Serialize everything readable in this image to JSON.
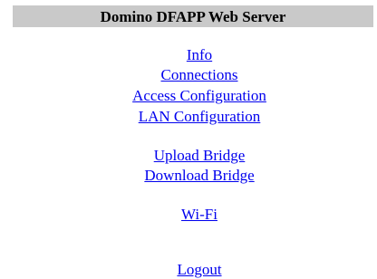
{
  "header": {
    "title": "Domino DFAPP Web Server"
  },
  "menu": {
    "group1": [
      {
        "label": "Info"
      },
      {
        "label": "Connections"
      },
      {
        "label": "Access Configuration"
      },
      {
        "label": "LAN Configuration"
      }
    ],
    "group2": [
      {
        "label": "Upload Bridge"
      },
      {
        "label": "Download Bridge"
      }
    ],
    "group3": [
      {
        "label": "Wi-Fi"
      }
    ],
    "logout": {
      "label": "Logout"
    }
  },
  "colors": {
    "header_bg": "#c9c9c9",
    "link": "#0000ee"
  }
}
